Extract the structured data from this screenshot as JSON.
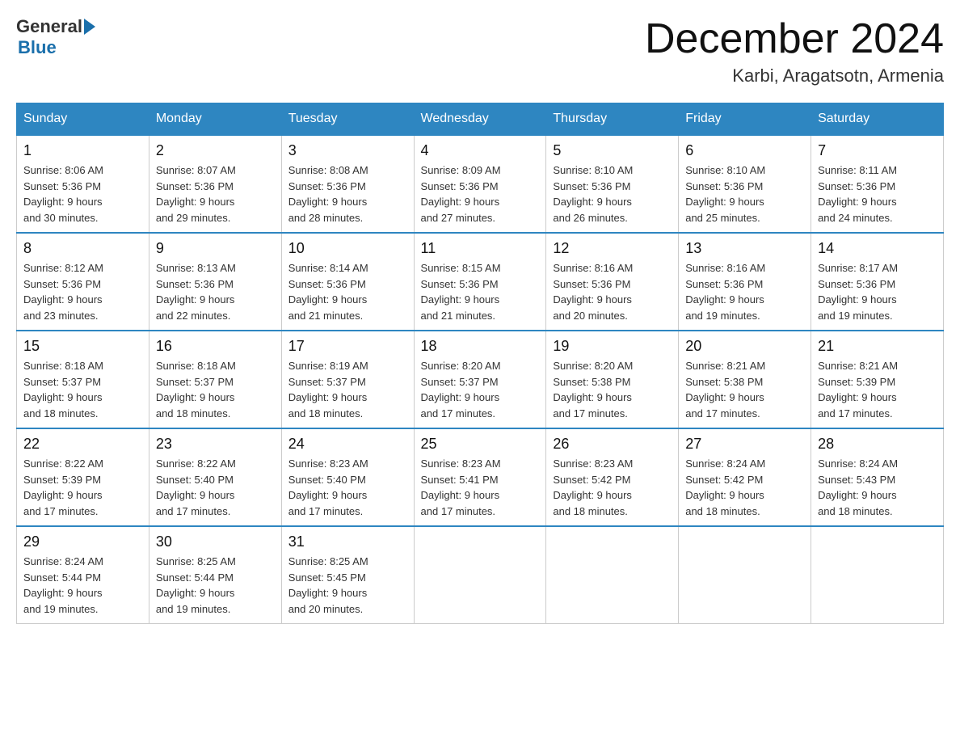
{
  "header": {
    "logo": {
      "general": "General",
      "blue": "Blue"
    },
    "title": "December 2024",
    "location": "Karbi, Aragatsotn, Armenia"
  },
  "days_of_week": [
    "Sunday",
    "Monday",
    "Tuesday",
    "Wednesday",
    "Thursday",
    "Friday",
    "Saturday"
  ],
  "weeks": [
    [
      {
        "day": "1",
        "sunrise": "Sunrise: 8:06 AM",
        "sunset": "Sunset: 5:36 PM",
        "daylight": "Daylight: 9 hours",
        "daylight2": "and 30 minutes."
      },
      {
        "day": "2",
        "sunrise": "Sunrise: 8:07 AM",
        "sunset": "Sunset: 5:36 PM",
        "daylight": "Daylight: 9 hours",
        "daylight2": "and 29 minutes."
      },
      {
        "day": "3",
        "sunrise": "Sunrise: 8:08 AM",
        "sunset": "Sunset: 5:36 PM",
        "daylight": "Daylight: 9 hours",
        "daylight2": "and 28 minutes."
      },
      {
        "day": "4",
        "sunrise": "Sunrise: 8:09 AM",
        "sunset": "Sunset: 5:36 PM",
        "daylight": "Daylight: 9 hours",
        "daylight2": "and 27 minutes."
      },
      {
        "day": "5",
        "sunrise": "Sunrise: 8:10 AM",
        "sunset": "Sunset: 5:36 PM",
        "daylight": "Daylight: 9 hours",
        "daylight2": "and 26 minutes."
      },
      {
        "day": "6",
        "sunrise": "Sunrise: 8:10 AM",
        "sunset": "Sunset: 5:36 PM",
        "daylight": "Daylight: 9 hours",
        "daylight2": "and 25 minutes."
      },
      {
        "day": "7",
        "sunrise": "Sunrise: 8:11 AM",
        "sunset": "Sunset: 5:36 PM",
        "daylight": "Daylight: 9 hours",
        "daylight2": "and 24 minutes."
      }
    ],
    [
      {
        "day": "8",
        "sunrise": "Sunrise: 8:12 AM",
        "sunset": "Sunset: 5:36 PM",
        "daylight": "Daylight: 9 hours",
        "daylight2": "and 23 minutes."
      },
      {
        "day": "9",
        "sunrise": "Sunrise: 8:13 AM",
        "sunset": "Sunset: 5:36 PM",
        "daylight": "Daylight: 9 hours",
        "daylight2": "and 22 minutes."
      },
      {
        "day": "10",
        "sunrise": "Sunrise: 8:14 AM",
        "sunset": "Sunset: 5:36 PM",
        "daylight": "Daylight: 9 hours",
        "daylight2": "and 21 minutes."
      },
      {
        "day": "11",
        "sunrise": "Sunrise: 8:15 AM",
        "sunset": "Sunset: 5:36 PM",
        "daylight": "Daylight: 9 hours",
        "daylight2": "and 21 minutes."
      },
      {
        "day": "12",
        "sunrise": "Sunrise: 8:16 AM",
        "sunset": "Sunset: 5:36 PM",
        "daylight": "Daylight: 9 hours",
        "daylight2": "and 20 minutes."
      },
      {
        "day": "13",
        "sunrise": "Sunrise: 8:16 AM",
        "sunset": "Sunset: 5:36 PM",
        "daylight": "Daylight: 9 hours",
        "daylight2": "and 19 minutes."
      },
      {
        "day": "14",
        "sunrise": "Sunrise: 8:17 AM",
        "sunset": "Sunset: 5:36 PM",
        "daylight": "Daylight: 9 hours",
        "daylight2": "and 19 minutes."
      }
    ],
    [
      {
        "day": "15",
        "sunrise": "Sunrise: 8:18 AM",
        "sunset": "Sunset: 5:37 PM",
        "daylight": "Daylight: 9 hours",
        "daylight2": "and 18 minutes."
      },
      {
        "day": "16",
        "sunrise": "Sunrise: 8:18 AM",
        "sunset": "Sunset: 5:37 PM",
        "daylight": "Daylight: 9 hours",
        "daylight2": "and 18 minutes."
      },
      {
        "day": "17",
        "sunrise": "Sunrise: 8:19 AM",
        "sunset": "Sunset: 5:37 PM",
        "daylight": "Daylight: 9 hours",
        "daylight2": "and 18 minutes."
      },
      {
        "day": "18",
        "sunrise": "Sunrise: 8:20 AM",
        "sunset": "Sunset: 5:37 PM",
        "daylight": "Daylight: 9 hours",
        "daylight2": "and 17 minutes."
      },
      {
        "day": "19",
        "sunrise": "Sunrise: 8:20 AM",
        "sunset": "Sunset: 5:38 PM",
        "daylight": "Daylight: 9 hours",
        "daylight2": "and 17 minutes."
      },
      {
        "day": "20",
        "sunrise": "Sunrise: 8:21 AM",
        "sunset": "Sunset: 5:38 PM",
        "daylight": "Daylight: 9 hours",
        "daylight2": "and 17 minutes."
      },
      {
        "day": "21",
        "sunrise": "Sunrise: 8:21 AM",
        "sunset": "Sunset: 5:39 PM",
        "daylight": "Daylight: 9 hours",
        "daylight2": "and 17 minutes."
      }
    ],
    [
      {
        "day": "22",
        "sunrise": "Sunrise: 8:22 AM",
        "sunset": "Sunset: 5:39 PM",
        "daylight": "Daylight: 9 hours",
        "daylight2": "and 17 minutes."
      },
      {
        "day": "23",
        "sunrise": "Sunrise: 8:22 AM",
        "sunset": "Sunset: 5:40 PM",
        "daylight": "Daylight: 9 hours",
        "daylight2": "and 17 minutes."
      },
      {
        "day": "24",
        "sunrise": "Sunrise: 8:23 AM",
        "sunset": "Sunset: 5:40 PM",
        "daylight": "Daylight: 9 hours",
        "daylight2": "and 17 minutes."
      },
      {
        "day": "25",
        "sunrise": "Sunrise: 8:23 AM",
        "sunset": "Sunset: 5:41 PM",
        "daylight": "Daylight: 9 hours",
        "daylight2": "and 17 minutes."
      },
      {
        "day": "26",
        "sunrise": "Sunrise: 8:23 AM",
        "sunset": "Sunset: 5:42 PM",
        "daylight": "Daylight: 9 hours",
        "daylight2": "and 18 minutes."
      },
      {
        "day": "27",
        "sunrise": "Sunrise: 8:24 AM",
        "sunset": "Sunset: 5:42 PM",
        "daylight": "Daylight: 9 hours",
        "daylight2": "and 18 minutes."
      },
      {
        "day": "28",
        "sunrise": "Sunrise: 8:24 AM",
        "sunset": "Sunset: 5:43 PM",
        "daylight": "Daylight: 9 hours",
        "daylight2": "and 18 minutes."
      }
    ],
    [
      {
        "day": "29",
        "sunrise": "Sunrise: 8:24 AM",
        "sunset": "Sunset: 5:44 PM",
        "daylight": "Daylight: 9 hours",
        "daylight2": "and 19 minutes."
      },
      {
        "day": "30",
        "sunrise": "Sunrise: 8:25 AM",
        "sunset": "Sunset: 5:44 PM",
        "daylight": "Daylight: 9 hours",
        "daylight2": "and 19 minutes."
      },
      {
        "day": "31",
        "sunrise": "Sunrise: 8:25 AM",
        "sunset": "Sunset: 5:45 PM",
        "daylight": "Daylight: 9 hours",
        "daylight2": "and 20 minutes."
      },
      null,
      null,
      null,
      null
    ]
  ]
}
